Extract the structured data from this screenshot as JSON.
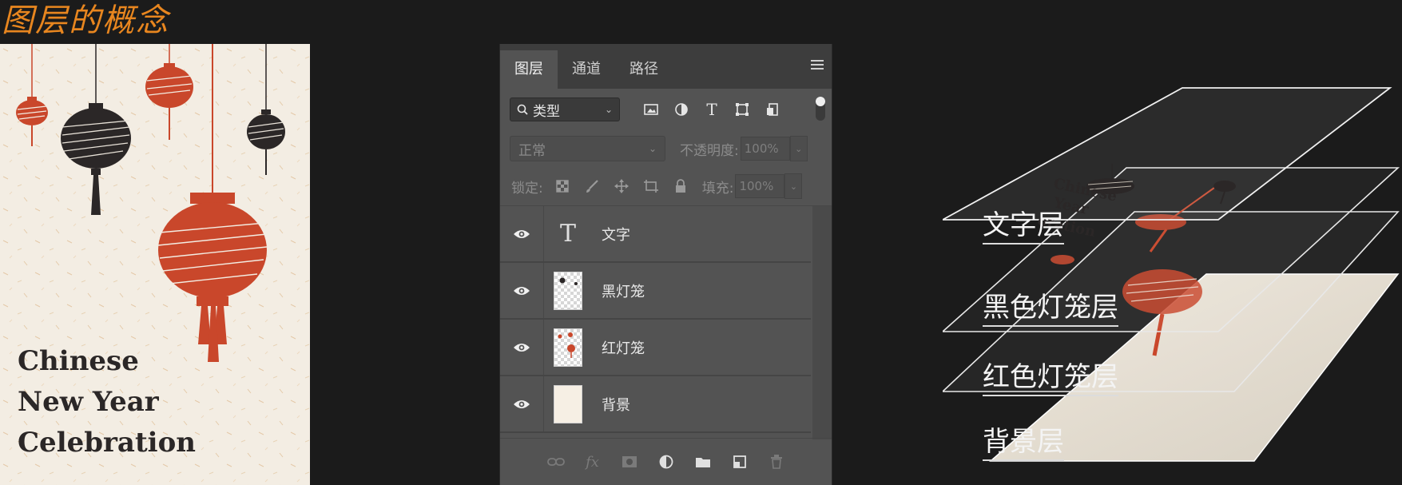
{
  "page_title": "图层的概念",
  "poster": {
    "title_lines": [
      "Chinese",
      "New Year",
      "Celebration"
    ],
    "colors": {
      "background": "#f3ede3",
      "red": "#c9472b",
      "dark": "#2b2727"
    }
  },
  "layers_panel": {
    "tabs": [
      {
        "label": "图层",
        "active": true
      },
      {
        "label": "通道",
        "active": false
      },
      {
        "label": "路径",
        "active": false
      }
    ],
    "filter": {
      "label": "类型",
      "icons": [
        "image-filter-icon",
        "adjustment-filter-icon",
        "type-filter-icon",
        "shape-filter-icon",
        "smart-object-filter-icon"
      ]
    },
    "blend_mode": "正常",
    "opacity_label": "不透明度:",
    "opacity_value": "100%",
    "lock_label": "锁定:",
    "fill_label": "填充:",
    "fill_value": "100%",
    "layers": [
      {
        "name": "文字",
        "kind": "text",
        "visible": true
      },
      {
        "name": "黑灯笼",
        "kind": "pixel",
        "visible": true
      },
      {
        "name": "红灯笼",
        "kind": "pixel",
        "visible": true
      },
      {
        "name": "背景",
        "kind": "background",
        "visible": true
      }
    ],
    "footer_icons": [
      "link-icon",
      "fx-icon",
      "mask-icon",
      "adjustment-icon",
      "folder-icon",
      "new-layer-icon",
      "trash-icon"
    ],
    "fx_text": "fx"
  },
  "stack": {
    "labels": [
      "文字层",
      "黑色灯笼层",
      "红色灯笼层",
      "背景层"
    ],
    "mini_text": [
      "Chinese",
      "Year",
      "oration"
    ]
  }
}
